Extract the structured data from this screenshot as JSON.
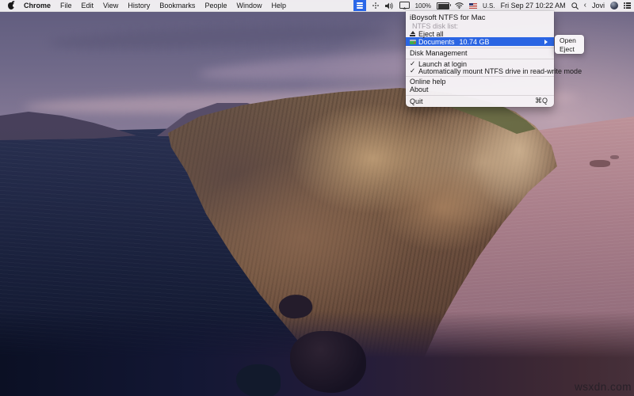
{
  "wallpaper": {
    "watermark": "wsxdn.com"
  },
  "menu_bar": {
    "app_menus": [
      "Chrome",
      "File",
      "Edit",
      "View",
      "History",
      "Bookmarks",
      "People",
      "Window",
      "Help"
    ],
    "status": {
      "battery": "100%",
      "input_source": "U.S.",
      "clock": "Fri Sep 27 10:22 AM",
      "user": "Jovi"
    }
  },
  "tray_menu": {
    "title": "iBoysoft NTFS for Mac",
    "section_label": "NTFS disk list:",
    "eject_all": "Eject all",
    "selected_disk": {
      "name": "Documents",
      "size": "10.74 GB"
    },
    "disk_management": "Disk Management",
    "check_glyph": "✓",
    "launch_at_login": "Launch at login",
    "auto_mount": "Automatically mount NTFS drive in read-write mode",
    "online_help": "Online help",
    "about": "About",
    "quit": "Quit",
    "quit_shortcut": "⌘Q"
  },
  "submenu": {
    "open": "Open",
    "eject": "Eject"
  },
  "colors": {
    "selection_blue": "#2b65e3",
    "menu_bg": "#f6f3f6",
    "tray_highlight": "#2a67e8"
  }
}
